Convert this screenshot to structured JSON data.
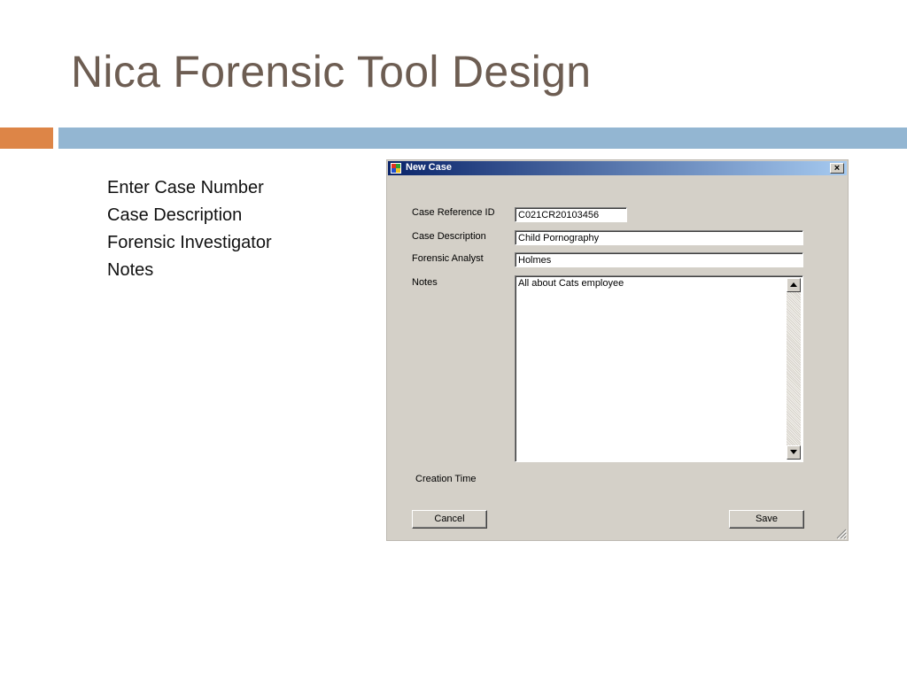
{
  "slide": {
    "title": "Nica Forensic Tool Design",
    "bullets": [
      "Enter Case Number",
      "Case Description",
      "Forensic Investigator",
      "Notes"
    ]
  },
  "dialog": {
    "title": "New Case",
    "close_label": "×",
    "fields": {
      "case_ref_label": "Case Reference ID",
      "case_ref_value": "C021CR20103456",
      "case_desc_label": "Case Description",
      "case_desc_value": "Child Pornography",
      "analyst_label": "Forensic Analyst",
      "analyst_value": "Holmes",
      "notes_label": "Notes",
      "notes_value": "All about Cats employee",
      "creation_time_label": "Creation Time"
    },
    "buttons": {
      "cancel": "Cancel",
      "save": "Save"
    }
  },
  "icons": {
    "app": "window-app-icon",
    "close": "close-icon",
    "scroll_up": "chevron-up-icon",
    "scroll_down": "chevron-down-icon",
    "grip": "resize-grip-icon"
  },
  "colors": {
    "title_text": "#6d5d52",
    "accent_orange": "#dd8547",
    "accent_blue": "#93b6d2",
    "dialog_bg": "#d4d0c8",
    "titlebar_start": "#0a246a",
    "titlebar_end": "#a6caf0"
  }
}
